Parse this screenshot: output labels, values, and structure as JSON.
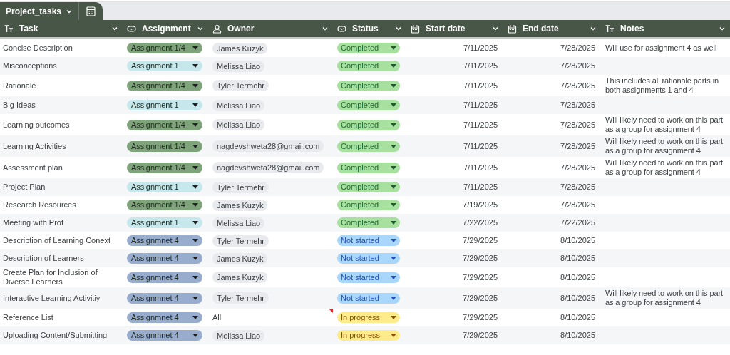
{
  "tab": {
    "title": "Project_tasks"
  },
  "columns": [
    {
      "label": "Task",
      "kind": "text"
    },
    {
      "label": "Assignment",
      "kind": "select"
    },
    {
      "label": "Owner",
      "kind": "person"
    },
    {
      "label": "Status",
      "kind": "select"
    },
    {
      "label": "Start date",
      "kind": "date"
    },
    {
      "label": "End date",
      "kind": "date"
    },
    {
      "label": "Notes",
      "kind": "text"
    }
  ],
  "rows": [
    {
      "task": "Concise Description",
      "assignment": {
        "label": "Assignment 1/4",
        "color": "#7fa37a"
      },
      "owner": {
        "kind": "person",
        "name": "James Kuzyk"
      },
      "status": {
        "kind": "completed",
        "label": "Completed"
      },
      "start": "7/11/2025",
      "end": "7/28/2025",
      "notes": "Will use for assignment 4 as well"
    },
    {
      "task": "Misconceptions",
      "assignment": {
        "label": "Assignment 1",
        "color": "#c6e8ec"
      },
      "owner": {
        "kind": "person",
        "name": "Melissa Liao"
      },
      "status": {
        "kind": "completed",
        "label": "Completed"
      },
      "start": "7/11/2025",
      "end": "7/28/2025"
    },
    {
      "task": "Rationale",
      "assignment": {
        "label": "Assignment 1/4",
        "color": "#7fa37a"
      },
      "owner": {
        "kind": "person",
        "name": "Tyler Termehr"
      },
      "status": {
        "kind": "completed",
        "label": "Completed"
      },
      "start": "7/11/2025",
      "end": "7/28/2025",
      "notes": "This includes all rationale parts in both assignments 1 and 4"
    },
    {
      "task": "Big Ideas",
      "assignment": {
        "label": "Assignment 1",
        "color": "#c6e8ec"
      },
      "owner": {
        "kind": "person",
        "name": "Melissa Liao"
      },
      "status": {
        "kind": "completed",
        "label": "Completed"
      },
      "start": "7/11/2025",
      "end": "7/28/2025"
    },
    {
      "task": "Learning outcomes",
      "assignment": {
        "label": "Assignment 1/4",
        "color": "#7fa37a"
      },
      "owner": {
        "kind": "person",
        "name": "Melissa Liao"
      },
      "status": {
        "kind": "completed",
        "label": "Completed"
      },
      "start": "7/11/2025",
      "end": "7/28/2025",
      "notes": "Will likely need to work on this part as a group for assignment 4"
    },
    {
      "task": "Learning Activities",
      "assignment": {
        "label": "Assignment 1/4",
        "color": "#7fa37a"
      },
      "owner": {
        "kind": "person",
        "name": "nagdevshweta28@gmail.com"
      },
      "status": {
        "kind": "completed",
        "label": "Completed"
      },
      "start": "7/11/2025",
      "end": "7/28/2025",
      "notes": "Will likely need to work on this part as a group for assignment 4"
    },
    {
      "task": "Assessment plan",
      "assignment": {
        "label": "Assignment 1/4",
        "color": "#7fa37a"
      },
      "owner": {
        "kind": "person",
        "name": "nagdevshweta28@gmail.com"
      },
      "status": {
        "kind": "completed",
        "label": "Completed"
      },
      "start": "7/11/2025",
      "end": "7/28/2025",
      "notes": "Will likely need to work on this part as a group for assignment 4"
    },
    {
      "task": "Project Plan",
      "assignment": {
        "label": "Assignment 1",
        "color": "#c6e8ec"
      },
      "owner": {
        "kind": "person",
        "name": "Tyler Termehr"
      },
      "status": {
        "kind": "completed",
        "label": "Completed"
      },
      "start": "7/11/2025",
      "end": "7/28/2025"
    },
    {
      "task": "Research Resources",
      "assignment": {
        "label": "Assignment 1/4",
        "color": "#7fa37a"
      },
      "owner": {
        "kind": "person",
        "name": "James Kuzyk"
      },
      "status": {
        "kind": "completed",
        "label": "Completed"
      },
      "start": "7/19/2025",
      "end": "7/28/2025"
    },
    {
      "task": "Meeting with Prof",
      "assignment": {
        "label": "Assignment 1",
        "color": "#c6e8ec"
      },
      "owner": {
        "kind": "person",
        "name": "Melissa Liao"
      },
      "status": {
        "kind": "completed",
        "label": "Completed"
      },
      "start": "7/22/2025",
      "end": "7/22/2025"
    },
    {
      "task": "Description of Learning Conext",
      "assignment": {
        "label": "Assignmnet 4",
        "color": "#98accd"
      },
      "owner": {
        "kind": "person",
        "name": "Tyler Termehr"
      },
      "status": {
        "kind": "not_started",
        "label": "Not started"
      },
      "start": "7/29/2025",
      "end": "8/10/2025"
    },
    {
      "task": "Description of Learners",
      "assignment": {
        "label": "Assignmnet 4",
        "color": "#98accd"
      },
      "owner": {
        "kind": "person",
        "name": "James Kuzyk"
      },
      "status": {
        "kind": "not_started",
        "label": "Not started"
      },
      "start": "7/29/2025",
      "end": "8/10/2025"
    },
    {
      "task": "Create Plan for Inclusion of Diverse Learners",
      "assignment": {
        "label": "Assignmnet 4",
        "color": "#98accd"
      },
      "owner": {
        "kind": "person",
        "name": "James Kuzyk"
      },
      "status": {
        "kind": "not_started",
        "label": "Not started"
      },
      "start": "7/29/2025",
      "end": "8/10/2025"
    },
    {
      "task": "Interactive Learning Activitiy",
      "assignment": {
        "label": "Assignmnet 4",
        "color": "#98accd"
      },
      "owner": {
        "kind": "person",
        "name": "Tyler Termehr"
      },
      "status": {
        "kind": "not_started",
        "label": "Not started"
      },
      "start": "7/29/2025",
      "end": "8/10/2025",
      "notes": "Will likely need to work on this part as a group for assignment 4"
    },
    {
      "task": "Reference List",
      "assignment": {
        "label": "Assignmnet 4",
        "color": "#98accd"
      },
      "owner": {
        "kind": "text",
        "name": "All",
        "comment": true
      },
      "status": {
        "kind": "in_progress",
        "label": "In progress"
      },
      "start": "7/29/2025",
      "end": "8/10/2025"
    },
    {
      "task": "Uploading Content/Submitting",
      "assignment": {
        "label": "Assignmnet 4",
        "color": "#98accd"
      },
      "owner": {
        "kind": "person",
        "name": "Melissa Liao"
      },
      "status": {
        "kind": "in_progress",
        "label": "In progress"
      },
      "start": "7/29/2025",
      "end": "8/10/2025"
    }
  ]
}
